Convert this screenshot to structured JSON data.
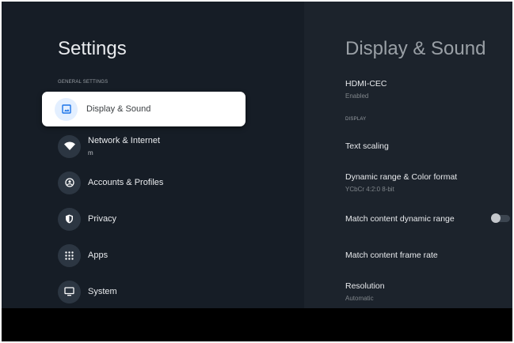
{
  "left": {
    "title": "Settings",
    "section": "GENERAL SETTINGS",
    "items": [
      {
        "label": "Display & Sound",
        "icon": "image-icon",
        "selected": true
      },
      {
        "label": "Network & Internet",
        "sub": "m",
        "icon": "wifi-icon"
      },
      {
        "label": "Accounts & Profiles",
        "icon": "account-icon"
      },
      {
        "label": "Privacy",
        "icon": "shield-icon"
      },
      {
        "label": "Apps",
        "icon": "apps-grid-icon"
      },
      {
        "label": "System",
        "icon": "monitor-icon"
      }
    ]
  },
  "right": {
    "title": "Display & Sound",
    "hdmi": {
      "label": "HDMI-CEC",
      "sub": "Enabled"
    },
    "section": "DISPLAY",
    "text_scaling": "Text scaling",
    "dynamic": {
      "label": "Dynamic range & Color format",
      "sub": "YCbCr 4:2:0 8-bit"
    },
    "match_range": {
      "label": "Match content dynamic range",
      "on": false
    },
    "match_rate": "Match content frame rate",
    "resolution": {
      "label": "Resolution",
      "sub": "Automatic"
    }
  },
  "colors": {
    "accent": "#1a73e8"
  }
}
